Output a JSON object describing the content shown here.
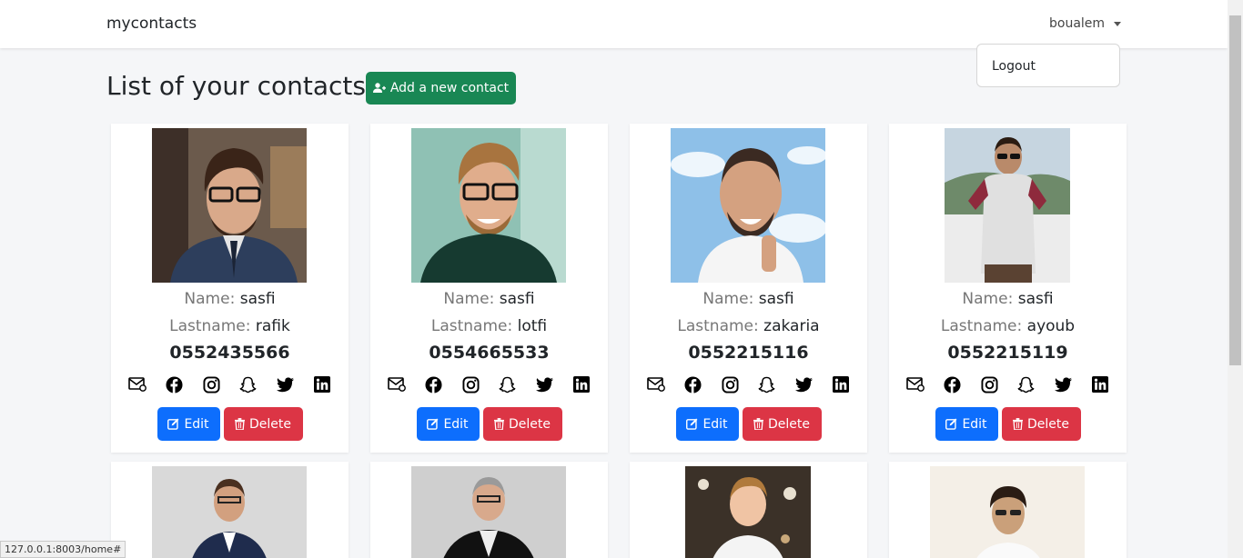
{
  "navbar": {
    "brand": "mycontacts",
    "user": "boualem"
  },
  "dropdown": {
    "logout": "Logout"
  },
  "page": {
    "title": "List of your contacts",
    "add_button": "Add a new contact"
  },
  "labels": {
    "name": "Name:",
    "lastname": "Lastname:",
    "edit": "Edit",
    "delete": "Delete"
  },
  "icons": [
    "email-icon",
    "facebook-icon",
    "instagram-icon",
    "snapchat-icon",
    "twitter-icon",
    "linkedin-icon"
  ],
  "contacts": [
    {
      "name": "sasfi",
      "lastname": "rafik",
      "phone": "0552435566"
    },
    {
      "name": "sasfi",
      "lastname": "lotfi",
      "phone": "0554665533"
    },
    {
      "name": "sasfi",
      "lastname": "zakaria",
      "phone": "0552215116"
    },
    {
      "name": "sasfi",
      "lastname": "ayoub",
      "phone": "0552215119"
    }
  ],
  "status_url": "127.0.0.1:8003/home#",
  "colors": {
    "add": "#198754",
    "edit": "#0d6efd",
    "delete": "#dc3545"
  }
}
